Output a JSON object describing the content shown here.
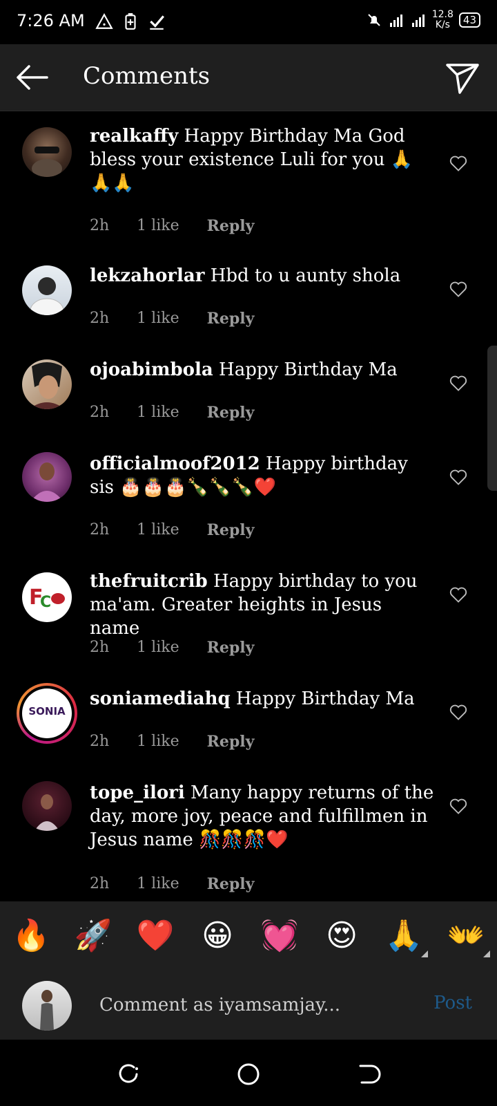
{
  "status": {
    "time": "7:26 AM",
    "network": "4G",
    "speed_value": "12.8",
    "speed_unit": "K/s",
    "battery": "43"
  },
  "header": {
    "title": "Comments"
  },
  "comments": [
    {
      "username": "realkaffy",
      "text": "Happy Birthday Ma God bless your existence Luli for you 🙏🙏🙏",
      "time": "2h",
      "likes": "1 like",
      "reply": "Reply"
    },
    {
      "username": "lekzahorlar",
      "text": "Hbd to u aunty shola",
      "time": "2h",
      "likes": "1 like",
      "reply": "Reply"
    },
    {
      "username": "ojoabimbola",
      "text": "Happy Birthday Ma",
      "time": "2h",
      "likes": "1 like",
      "reply": "Reply"
    },
    {
      "username": "officialmoof2012",
      "text": "Happy birthday sis 🎂🎂🎂🍾🍾🍾❤️",
      "time": "2h",
      "likes": "1 like",
      "reply": "Reply"
    },
    {
      "username": "thefruitcrib",
      "text": "Happy birthday to you ma'am. Greater heights in Jesus name",
      "time": "2h",
      "likes": "1 like",
      "reply": "Reply"
    },
    {
      "username": "soniamediahq",
      "text": "Happy Birthday Ma",
      "time": "2h",
      "likes": "1 like",
      "reply": "Reply",
      "avatar_text": "SONIA"
    },
    {
      "username": "tope_ilori",
      "text": "Many happy returns of the day, more joy, peace and fulfillmen in Jesus name 🎊🎊🎊❤️",
      "time": "2h",
      "likes": "1 like",
      "reply": "Reply"
    }
  ],
  "emoji_bar": [
    "🔥",
    "🚀",
    "❤️",
    "😀",
    "💓",
    "😍",
    "🙏",
    "👐"
  ],
  "composer": {
    "placeholder": "Comment as iyamsamjay...",
    "post_label": "Post"
  },
  "colors": {
    "background": "#000000",
    "header": "#1f1f1f",
    "meta_text": "#9a9a9a",
    "post_button": "#1e5a8a"
  }
}
